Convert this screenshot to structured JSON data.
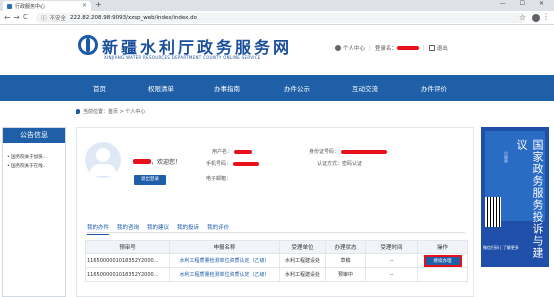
{
  "browser": {
    "tab_title": "行政服务中心",
    "tab_close": "×",
    "new_tab": "+",
    "window_controls": "—  ☐  ✕",
    "back": "←",
    "forward": "→",
    "reload": "C",
    "home": "⌂",
    "secure_label": "不安全",
    "url": "222.82.208.98:9093/xzsp_web/index/index.do",
    "star": "☆",
    "menu": "⋮"
  },
  "header": {
    "title": "新疆水利厅政务服务网",
    "subtitle": "XINJIANG WATER RESOURCES DEPARTMENT COUNTY ONLINE SERVICE",
    "personal_center": "个人中心",
    "login_label": "登录名：",
    "logout": "退出",
    "accent_color": "#1a5aa8",
    "redaction_color": "#e8101a"
  },
  "nav": {
    "items": [
      "首页",
      "权限清单",
      "办事指南",
      "办件公示",
      "互动交流",
      "办件评价"
    ]
  },
  "breadcrumb": "当前位置：首页 > 个人中心",
  "notice": {
    "title": "公告信息",
    "items": [
      "• 国务院关于加快...",
      "• 国务院关于在线..."
    ]
  },
  "profile": {
    "welcome_suffix": "，欢迎您！",
    "logout_button": "退出登录",
    "username_label": "用户名：",
    "phone_label": "手机号码：",
    "email_label": "电子邮箱：",
    "id_label": "身份证号码：",
    "auth_label": "认证方式：",
    "auth_value": "密码认证"
  },
  "tabs": [
    "我的办件",
    "我的咨询",
    "我的建议",
    "我的投诉",
    "我的评价"
  ],
  "table": {
    "headers": [
      "预审号",
      "申报名称",
      "受理单位",
      "办理状态",
      "受理时间",
      "操作"
    ],
    "rows": [
      {
        "id": "1165000001018352Y2000...",
        "name": "水利工程质量检测单位资质认定（乙级）",
        "unit": "水利工程建设处",
        "status": "草稿",
        "time": "--",
        "action": "继续办理"
      },
      {
        "id": "1165000001018352Y2000...",
        "name": "水利工程质量检测单位资质认定（乙级）",
        "unit": "水利工程建设处",
        "status": "预审中",
        "time": "--",
        "action": ""
      }
    ]
  },
  "ad": {
    "title": "国家政务服务投诉与建议",
    "small": "小程序",
    "footer": "微信扫码 | 了解更多"
  }
}
